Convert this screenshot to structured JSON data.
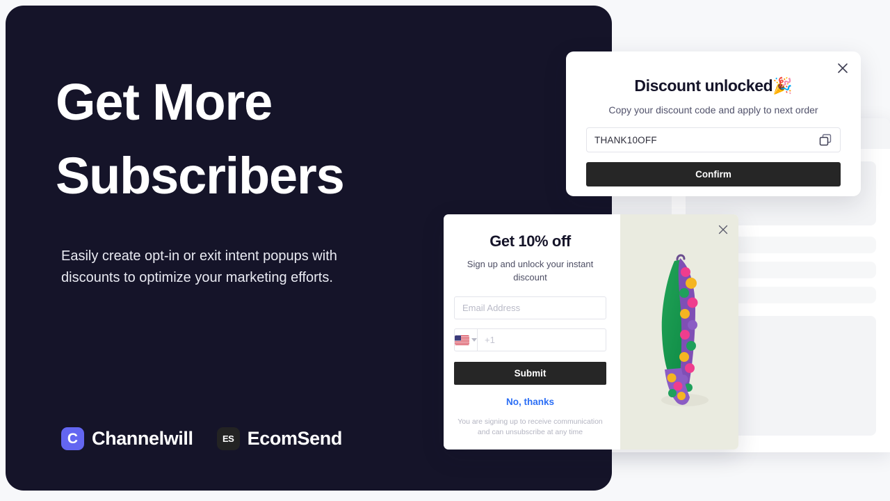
{
  "hero": {
    "title_line1": "Get More",
    "title_line2": "Subscribers",
    "subtitle": "Easily create opt-in or exit intent popups with discounts to optimize your marketing efforts.",
    "brands": [
      {
        "mark": "C",
        "name": "Channelwill",
        "color": "#6366f1"
      },
      {
        "mark": "ES",
        "name": "EcomSend",
        "color": "#232323"
      }
    ]
  },
  "browser": {
    "traffic_lights": [
      "red",
      "yellow",
      "green"
    ]
  },
  "discount_popup": {
    "title": "Discount unlocked",
    "title_emoji": "🎉",
    "subtitle": "Copy your discount code and apply to next order",
    "code": "THANK10OFF",
    "copy_icon": "copy-icon",
    "close_icon": "close-icon",
    "confirm_label": "Confirm"
  },
  "signup_popup": {
    "title": "Get 10% off",
    "subtitle": "Sign up and unlock your instant discount",
    "email_placeholder": "Email Address",
    "email_value": "",
    "country_flag": "us-flag-icon",
    "phone_placeholder": "+1",
    "phone_value": "",
    "submit_label": "Submit",
    "decline_label": "No, thanks",
    "legal": "You are signing up to receive communication and can unsubscribe at any time",
    "close_icon": "close-icon",
    "image_alt": "green floral hanging garment"
  },
  "colors": {
    "hero_bg": "#151429",
    "page_bg": "#f7f8fa",
    "accent_link": "#2b6ef5",
    "button_dark": "#262626",
    "brand_purple": "#6366f1",
    "image_panel": "#eaebe0"
  }
}
